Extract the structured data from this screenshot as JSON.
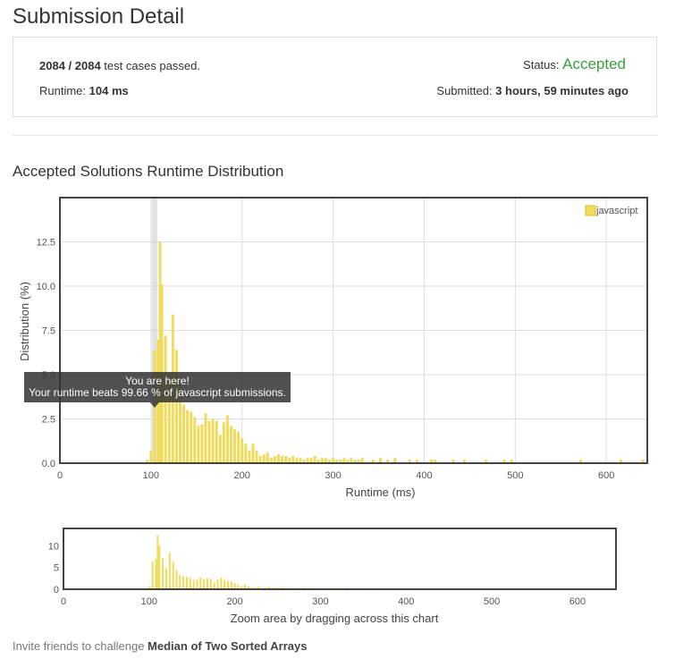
{
  "page": {
    "title": "Submission Detail"
  },
  "summary": {
    "passed": "2084",
    "separator": " / ",
    "total": "2084",
    "passed_suffix": " test cases passed.",
    "runtime_label": "Runtime: ",
    "runtime_value": "104 ms",
    "status_label": "Status: ",
    "status_value": "Accepted",
    "submitted_label": "Submitted: ",
    "submitted_value": "3 hours, 59 minutes ago"
  },
  "colors": {
    "accepted": "#3c9d3c",
    "bar": "#f0dc5a",
    "bar_stroke": "#d9c230",
    "tooltip_bg": "#333333"
  },
  "section": {
    "title": "Accepted Solutions Runtime Distribution"
  },
  "tooltip": {
    "line1": "You are here!",
    "line2": "Your runtime beats 99.66 % of javascript submissions."
  },
  "chart_data": [
    {
      "type": "bar",
      "legend": [
        "javascript"
      ],
      "xlabel": "Runtime (ms)",
      "ylabel": "Distribution (%)",
      "xlim": [
        0,
        645
      ],
      "ylim": [
        0,
        15
      ],
      "xticks": [
        0,
        100,
        200,
        300,
        400,
        500,
        600
      ],
      "yticks": [
        "0.0",
        "2.5",
        "5.0",
        "7.5",
        "10.0",
        "12.5"
      ],
      "grid": true,
      "legend_position": "top-right",
      "highlight_x": 104,
      "series": [
        {
          "name": "javascript",
          "x": [
            96,
            100,
            104,
            108,
            110,
            112,
            116,
            120,
            124,
            128,
            132,
            136,
            140,
            144,
            148,
            152,
            156,
            160,
            164,
            168,
            172,
            176,
            180,
            184,
            188,
            192,
            196,
            200,
            204,
            208,
            212,
            216,
            220,
            224,
            228,
            232,
            236,
            240,
            244,
            248,
            252,
            256,
            260,
            264,
            268,
            272,
            276,
            280,
            284,
            288,
            292,
            296,
            300,
            304,
            308,
            312,
            316,
            320,
            324,
            328,
            332,
            344,
            352,
            360,
            368,
            384,
            392,
            408,
            412,
            432,
            444,
            468,
            488,
            496,
            572,
            616,
            640
          ],
          "values": [
            0.2,
            0.7,
            6.4,
            7.0,
            12.5,
            10.1,
            7.2,
            4.9,
            8.4,
            6.4,
            4.5,
            3.3,
            3.0,
            2.9,
            2.6,
            2.1,
            2.2,
            2.8,
            2.4,
            2.5,
            2.4,
            1.6,
            2.3,
            2.7,
            2.1,
            1.9,
            1.8,
            1.4,
            1.1,
            0.7,
            1.1,
            0.7,
            0.4,
            0.5,
            0.6,
            0.3,
            0.4,
            0.5,
            0.4,
            0.4,
            0.3,
            0.4,
            0.3,
            0.3,
            0.2,
            0.3,
            0.3,
            0.4,
            0.2,
            0.3,
            0.3,
            0.2,
            0.3,
            0.2,
            0.2,
            0.3,
            0.2,
            0.3,
            0.2,
            0.2,
            0.3,
            0.2,
            0.3,
            0.2,
            0.3,
            0.2,
            0.2,
            0.2,
            0.2,
            0.2,
            0.2,
            0.2,
            0.2,
            0.2,
            0.2,
            0.2,
            0.2
          ]
        }
      ]
    },
    {
      "type": "bar",
      "xlabel": "Zoom area by dragging across this chart",
      "xlim": [
        0,
        645
      ],
      "ylim": [
        0,
        14
      ],
      "xticks": [
        0,
        100,
        200,
        300,
        400,
        500,
        600
      ],
      "yticks": [
        "0",
        "5",
        "10"
      ],
      "grid": false,
      "series_ref": "javascript"
    }
  ],
  "footer": {
    "prefix": "Invite friends to challenge ",
    "problem": "Median of Two Sorted Arrays"
  }
}
